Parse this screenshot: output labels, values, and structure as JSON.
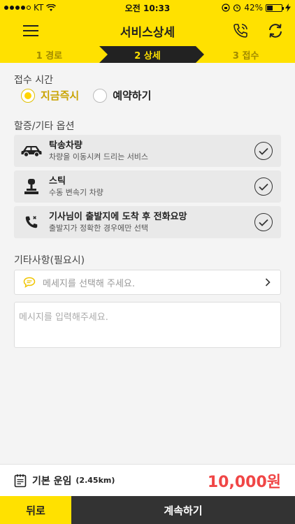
{
  "status_bar": {
    "carrier": "KT",
    "time": "오전 10:33",
    "battery": "42%",
    "battery_level": 0.42
  },
  "header": {
    "title": "서비스상세",
    "menu_icon": "menu-icon",
    "call_icon": "phone-call-icon",
    "refresh_icon": "refresh-icon"
  },
  "steps": [
    {
      "label": "1 경로",
      "active": false
    },
    {
      "label": "2 상세",
      "active": true
    },
    {
      "label": "3 접수",
      "active": false
    }
  ],
  "reception": {
    "label": "접수 시간",
    "options": [
      {
        "label": "지금즉시",
        "selected": true
      },
      {
        "label": "예약하기",
        "selected": false
      }
    ]
  },
  "extra_options": {
    "label": "할증/기타 옵션",
    "items": [
      {
        "title": "탁송차량",
        "subtitle": "차량을 이동시켜 드리는 서비스",
        "icon": "car-icon"
      },
      {
        "title": "스틱",
        "subtitle": "수동 변속기 차량",
        "icon": "gear-stick-icon"
      },
      {
        "title": "기사님이 출발지에 도착 후 전화요망",
        "subtitle": "출발지가 정확한 경우에만 선택",
        "icon": "phone-icon"
      }
    ]
  },
  "etc": {
    "label": "기타사항(필요시)",
    "select_placeholder": "메세지를 선택해 주세요.",
    "textarea_placeholder": "메시지를 입력해주세요."
  },
  "price": {
    "label": "기본 운임",
    "distance": "(2.45km)",
    "value": "10,000원"
  },
  "buttons": {
    "back": "뒤로",
    "next": "계속하기"
  },
  "colors": {
    "brand_yellow": "#ffe100",
    "dark": "#333333",
    "price_red": "#f04646"
  }
}
